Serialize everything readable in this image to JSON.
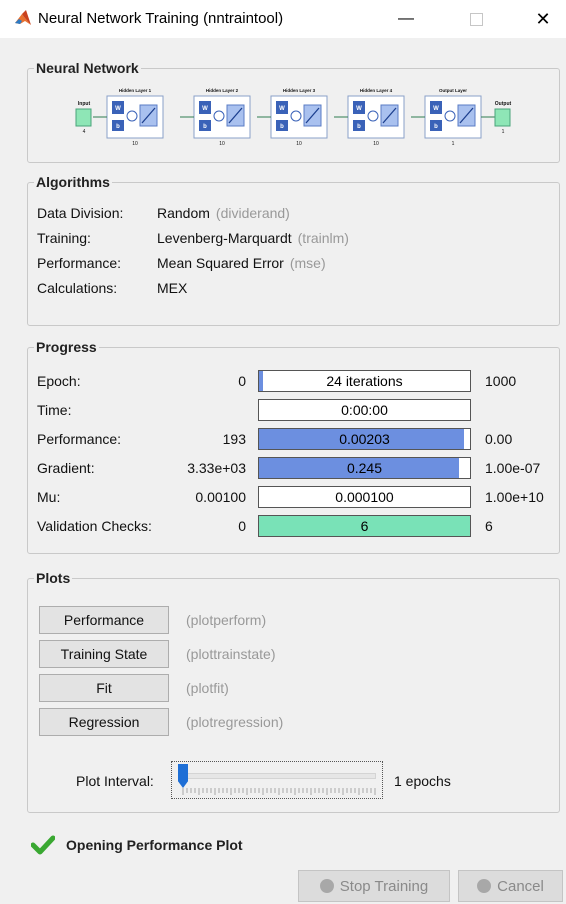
{
  "window": {
    "title": "Neural Network Training (nntraintool)",
    "minimize": "—",
    "close": "✕"
  },
  "neural_network": {
    "title": "Neural Network",
    "input_label": "Input",
    "input_size": "4",
    "layers": [
      {
        "label": "Hidden Layer 1",
        "size": "10"
      },
      {
        "label": "Hidden Layer 2",
        "size": "10"
      },
      {
        "label": "Hidden Layer 3",
        "size": "10"
      },
      {
        "label": "Hidden Layer 4",
        "size": "10"
      },
      {
        "label": "Output Layer",
        "size": "1"
      }
    ],
    "output_label": "Output",
    "output_size": "1",
    "w_label": "W",
    "b_label": "b"
  },
  "algorithms": {
    "title": "Algorithms",
    "rows": [
      {
        "label": "Data Division:",
        "value": "Random",
        "fn": "(dividerand)"
      },
      {
        "label": "Training:",
        "value": "Levenberg-Marquardt",
        "fn": "(trainlm)"
      },
      {
        "label": "Performance:",
        "value": "Mean Squared Error",
        "fn": "(mse)"
      },
      {
        "label": "Calculations:",
        "value": "MEX",
        "fn": ""
      }
    ]
  },
  "progress": {
    "title": "Progress",
    "rows": [
      {
        "label": "Epoch:",
        "start": "0",
        "value": "24 iterations",
        "end": "1000",
        "fill": 0.024,
        "color": "#6c8fe0"
      },
      {
        "label": "Time:",
        "start": "",
        "value": "0:00:00",
        "end": "",
        "fill": 0,
        "color": "#6c8fe0"
      },
      {
        "label": "Performance:",
        "start": "193",
        "value": "0.00203",
        "end": "0.00",
        "fill": 0.97,
        "color": "#6c8fe0"
      },
      {
        "label": "Gradient:",
        "start": "3.33e+03",
        "value": "0.245",
        "end": "1.00e-07",
        "fill": 0.95,
        "color": "#6c8fe0"
      },
      {
        "label": "Mu:",
        "start": "0.00100",
        "value": "0.000100",
        "end": "1.00e+10",
        "fill": 0,
        "color": "#6c8fe0"
      },
      {
        "label": "Validation Checks:",
        "start": "0",
        "value": "6",
        "end": "6",
        "fill": 1.0,
        "color": "#79e2b7"
      }
    ]
  },
  "plots": {
    "title": "Plots",
    "buttons": [
      {
        "label": "Performance",
        "fn": "(plotperform)"
      },
      {
        "label": "Training State",
        "fn": "(plottrainstate)"
      },
      {
        "label": "Fit",
        "fn": "(plotfit)"
      },
      {
        "label": "Regression",
        "fn": "(plotregression)"
      }
    ],
    "interval_label": "Plot Interval:",
    "interval_value": "1 epochs",
    "slider_level": 0
  },
  "status": {
    "text": "Opening Performance Plot"
  },
  "actions": {
    "stop": "Stop Training",
    "cancel": "Cancel"
  },
  "colors": {
    "accent_blue": "#6c8fe0",
    "validation_green": "#79e2b7",
    "io_green": "#8ee6b6",
    "check_green": "#3aa832",
    "slider_blue": "#1e6fd6"
  }
}
